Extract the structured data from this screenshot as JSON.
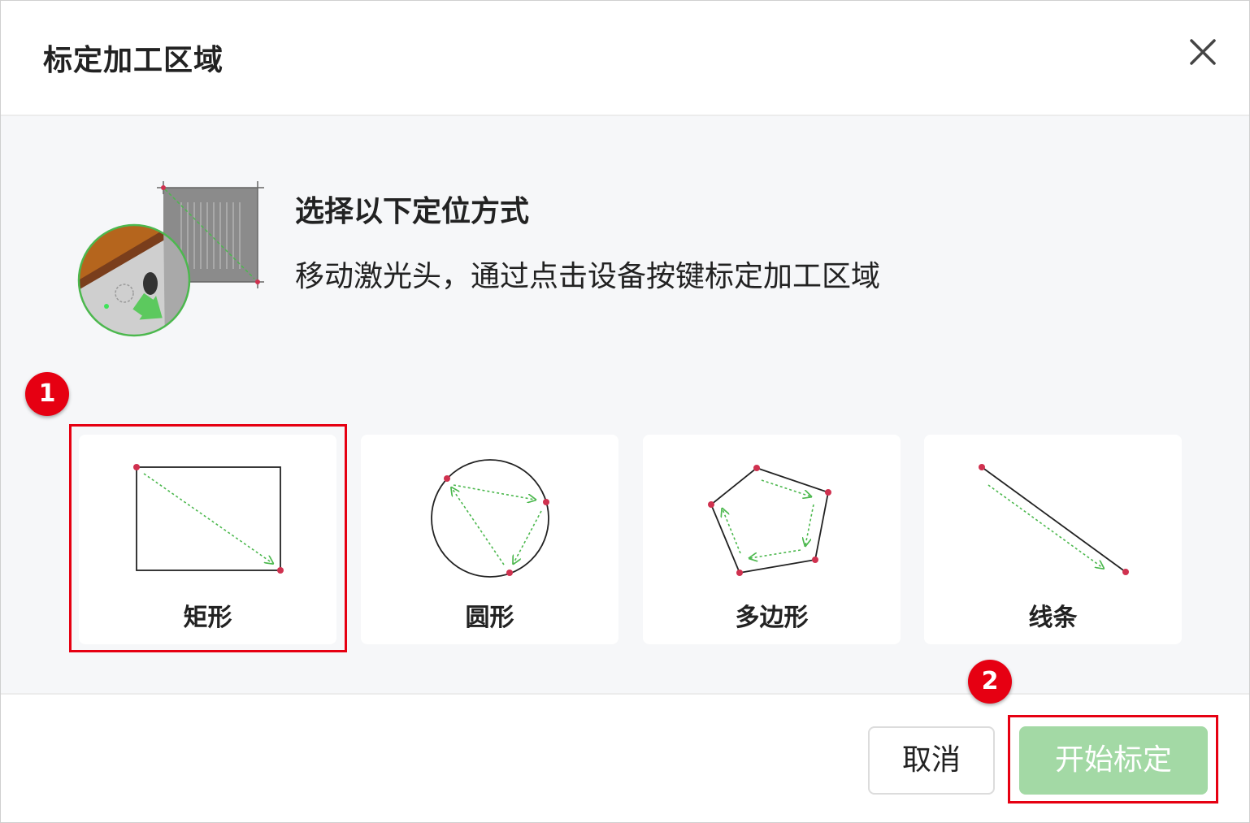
{
  "dialog": {
    "title": "标定加工区域",
    "close_icon": "close-icon"
  },
  "intro": {
    "heading": "选择以下定位方式",
    "description": "移动激光头，通过点击设备按键标定加工区域",
    "illustration_icon": "laser-device-button-illustration"
  },
  "options": [
    {
      "label": "矩形",
      "icon": "rectangle-shape-icon",
      "selected": true
    },
    {
      "label": "圆形",
      "icon": "circle-shape-icon",
      "selected": false
    },
    {
      "label": "多边形",
      "icon": "polygon-shape-icon",
      "selected": false
    },
    {
      "label": "线条",
      "icon": "line-shape-icon",
      "selected": false
    }
  ],
  "annotations": [
    {
      "number": "1"
    },
    {
      "number": "2"
    }
  ],
  "footer": {
    "cancel_label": "取消",
    "start_label": "开始标定"
  },
  "colors": {
    "accent_green": "#4cb84e",
    "primary_disabled": "#a3d9a5",
    "point_red": "#d0314f",
    "annotation_red": "#e60012"
  }
}
